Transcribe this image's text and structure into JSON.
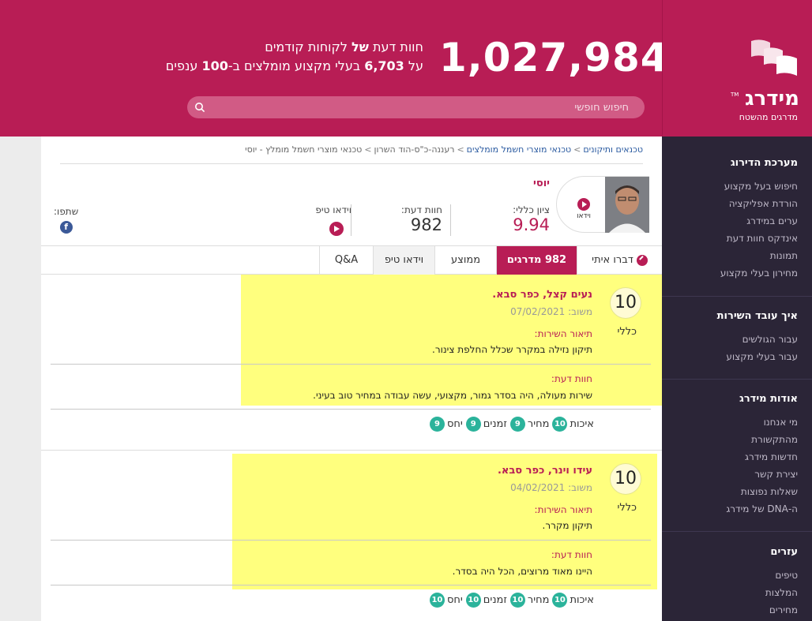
{
  "header": {
    "counter": "1,027,984",
    "tagline_line1_pre": "חוות דעת",
    "tagline_line1_bold": "של",
    "tagline_line1_post": "לקוחות קודמים",
    "tagline_line2_pre": "על",
    "tagline_line2_num": "6,703",
    "tagline_line2_mid": "בעלי מקצוע מומלצים ב-",
    "tagline_line2_num2": "100",
    "tagline_line2_post": "ענפים",
    "search_placeholder": "חיפוש חופשי"
  },
  "brand": {
    "name": "מידרג",
    "tm": "TM",
    "slogan": "מדרגים מהשטח"
  },
  "sidebar": {
    "sections": [
      {
        "title": "מערכת הדירוג",
        "items": [
          "חיפוש בעל מקצוע",
          "הורדת אפליקציה",
          "ערים במידרג",
          "אינדקס חוות דעת",
          "תמונות",
          "מחירון בעלי מקצוע"
        ]
      },
      {
        "title": "איך עובד השירות",
        "items": [
          "עבור הגולשים",
          "עבור בעלי מקצוע"
        ]
      },
      {
        "title": "אודות מידרג",
        "items": [
          "מי אנחנו",
          "מהתקשורת",
          "חדשות מידרג",
          "יצירת קשר",
          "שאלות נפוצות",
          "ה-DNA של מידרג"
        ]
      },
      {
        "title": "עזרים",
        "items": [
          "טיפים",
          "המלצות",
          "מחירים"
        ]
      }
    ]
  },
  "breadcrumb": {
    "items": [
      "טכנאים ותיקונים",
      "טכנאי מוצרי חשמל מומלצים",
      "רעננה-כ\"ס-הוד השרון",
      "טכנאי מוצרי חשמל מומלץ - יוסי"
    ]
  },
  "profile": {
    "name": "יוסי",
    "video_label": "וידאו",
    "score_label": "ציון כללי:",
    "score_value": "9.94",
    "opinions_label": "חוות דעת:",
    "opinions_value": "982",
    "video_tip_label": "וידאו טיפ",
    "share_label": "שתפו:"
  },
  "tabs": [
    "דברו איתי",
    "982 מדרגים",
    "ממוצע",
    "וידאו טיפ",
    "Q&A"
  ],
  "reviews": [
    {
      "score": "10",
      "score_label": "כללי",
      "name": "נעים קצל, כפר סבא.",
      "date_label": "משוב:",
      "date": "07/02/2021",
      "service_label": "תיאור השירות:",
      "service_text": "תיקון נזילה במקרר שכלל החלפת צינור.",
      "opinion_label": "חוות דעת:",
      "opinion_text": "שירות מעולה, היה בסדר גמור, מקצועי, עשה עבודה במחיר טוב בעיני.",
      "ratings": [
        {
          "label": "איכות",
          "value": "10"
        },
        {
          "label": "מחיר",
          "value": "9"
        },
        {
          "label": "זמנים",
          "value": "9"
        },
        {
          "label": "יחס",
          "value": "9"
        }
      ]
    },
    {
      "score": "10",
      "score_label": "כללי",
      "name": "עידו וינר, כפר סבא.",
      "date_label": "משוב:",
      "date": "04/02/2021",
      "service_label": "תיאור השירות:",
      "service_text": "תיקון מקרר.",
      "opinion_label": "חוות דעת:",
      "opinion_text": "היינו מאוד מרוצים, הכל היה בסדר.",
      "ratings": [
        {
          "label": "איכות",
          "value": "10"
        },
        {
          "label": "מחיר",
          "value": "10"
        },
        {
          "label": "זמנים",
          "value": "10"
        },
        {
          "label": "יחס",
          "value": "10"
        }
      ]
    }
  ],
  "colors": {
    "brand": "#b81d55",
    "sidebar": "#2b2537",
    "highlight": "#ffff7e",
    "badge": "#2bb39b"
  }
}
